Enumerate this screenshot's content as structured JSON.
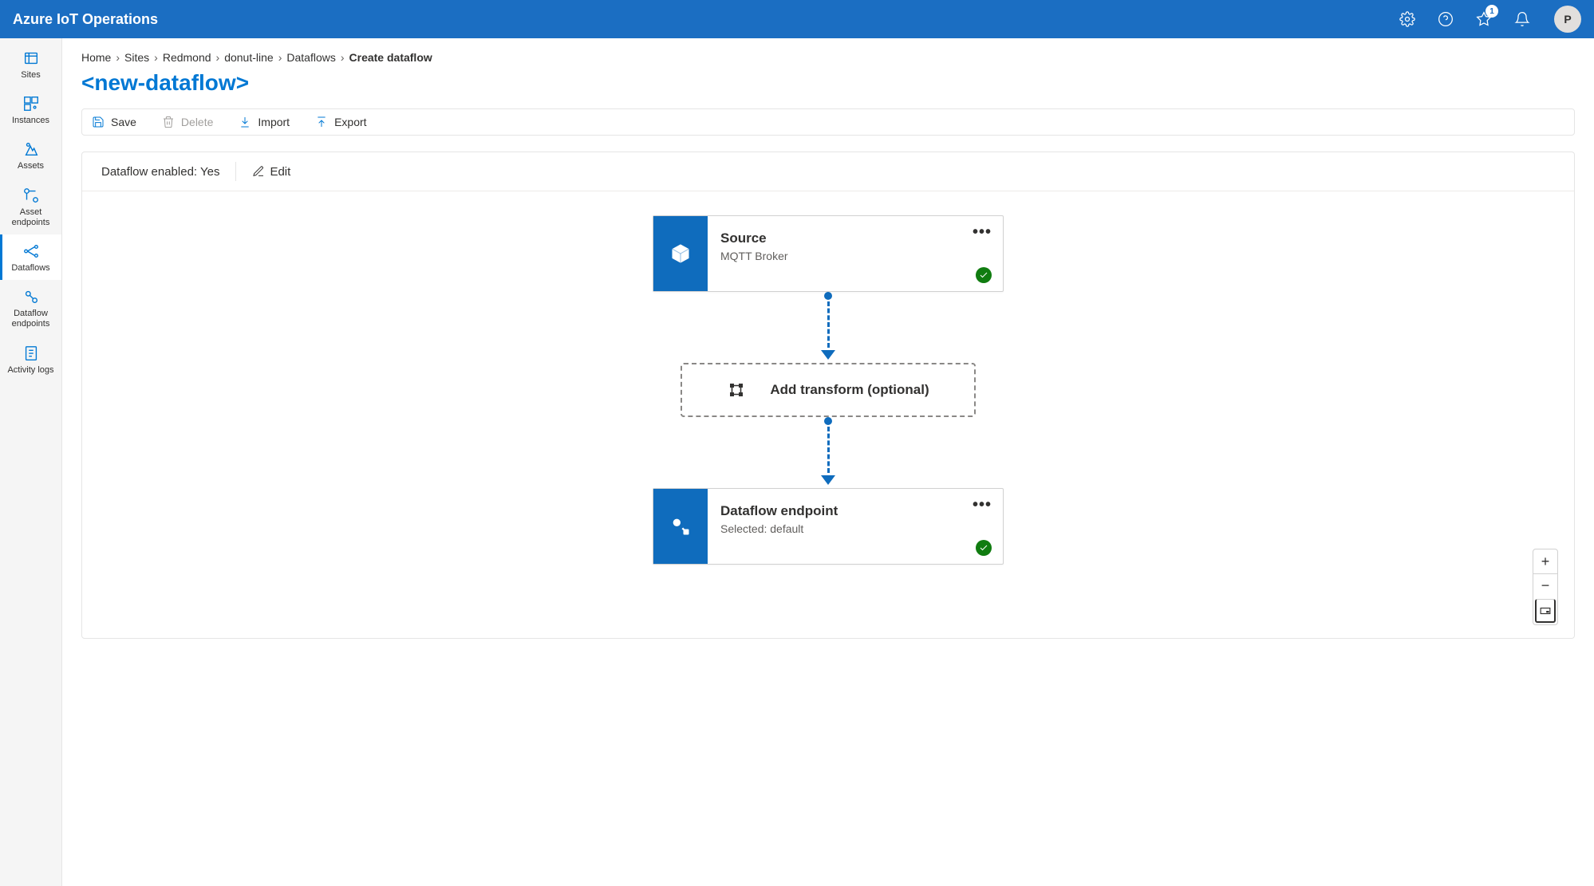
{
  "header": {
    "title": "Azure IoT Operations",
    "notification_badge": "1",
    "avatar_initial": "P"
  },
  "sidebar": {
    "items": [
      {
        "label": "Sites"
      },
      {
        "label": "Instances"
      },
      {
        "label": "Assets"
      },
      {
        "label": "Asset endpoints"
      },
      {
        "label": "Dataflows"
      },
      {
        "label": "Dataflow endpoints"
      },
      {
        "label": "Activity logs"
      }
    ]
  },
  "breadcrumb": {
    "items": [
      "Home",
      "Sites",
      "Redmond",
      "donut-line",
      "Dataflows"
    ],
    "current": "Create dataflow"
  },
  "page": {
    "title": "<new-dataflow>"
  },
  "commands": {
    "save": "Save",
    "delete": "Delete",
    "import": "Import",
    "export": "Export"
  },
  "canvas": {
    "enabled_text": "Dataflow enabled: Yes",
    "edit_label": "Edit",
    "source": {
      "title": "Source",
      "subtitle": "MQTT Broker"
    },
    "transform": {
      "label": "Add transform (optional)"
    },
    "endpoint": {
      "title": "Dataflow endpoint",
      "subtitle": "Selected: default"
    }
  }
}
